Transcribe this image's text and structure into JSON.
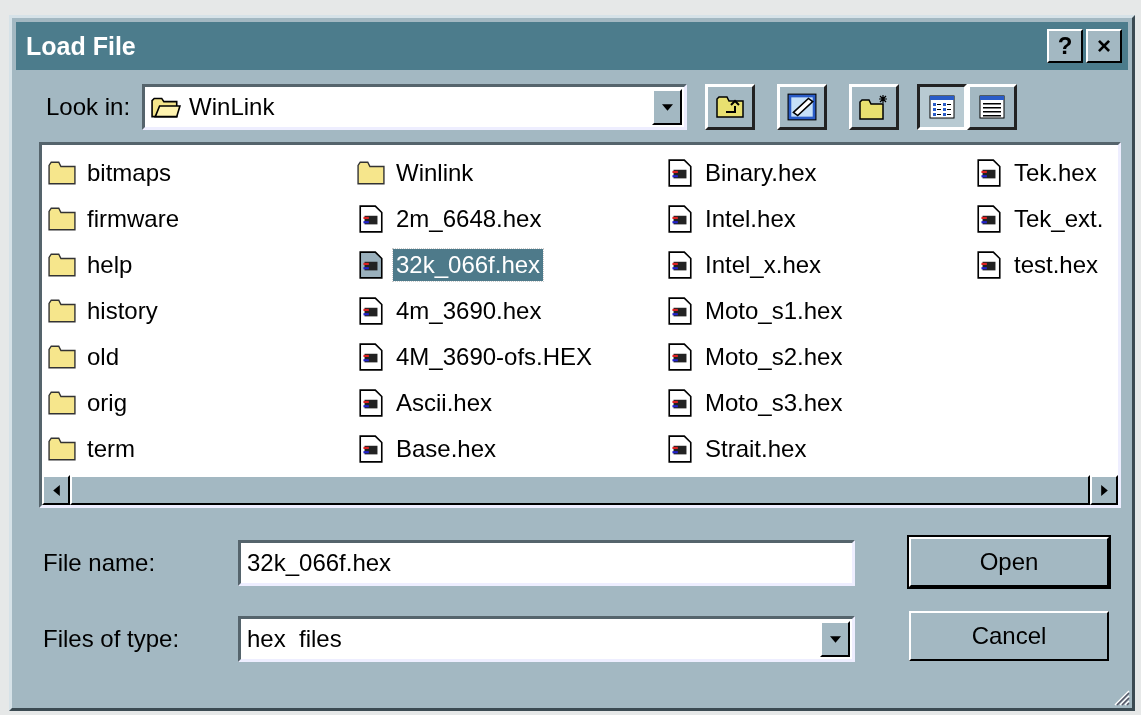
{
  "window": {
    "title": "Load File",
    "title_buttons": [
      "?",
      "×"
    ]
  },
  "look_in": {
    "label": "Look in:",
    "value": "WinLink"
  },
  "toolbar": [
    {
      "kind": "up",
      "selected": false
    },
    {
      "kind": "desktop",
      "selected": false
    },
    {
      "kind": "newfolder",
      "selected": false
    },
    {
      "kind": "list",
      "selected": true
    },
    {
      "kind": "details",
      "selected": false
    }
  ],
  "files": [
    {
      "name": "bitmaps",
      "kind": "folder",
      "selected": false
    },
    {
      "name": "firmware",
      "kind": "folder",
      "selected": false
    },
    {
      "name": "help",
      "kind": "folder",
      "selected": false
    },
    {
      "name": "history",
      "kind": "folder",
      "selected": false
    },
    {
      "name": "old",
      "kind": "folder",
      "selected": false
    },
    {
      "name": "orig",
      "kind": "folder",
      "selected": false
    },
    {
      "name": "term",
      "kind": "folder",
      "selected": false
    },
    {
      "name": "Winlink",
      "kind": "folder",
      "selected": false
    },
    {
      "name": "2m_6648.hex",
      "kind": "file",
      "selected": false
    },
    {
      "name": "32k_066f.hex",
      "kind": "file",
      "selected": true
    },
    {
      "name": "4m_3690.hex",
      "kind": "file",
      "selected": false
    },
    {
      "name": "4M_3690-ofs.HEX",
      "kind": "file",
      "selected": false
    },
    {
      "name": "Ascii.hex",
      "kind": "file",
      "selected": false
    },
    {
      "name": "Base.hex",
      "kind": "file",
      "selected": false
    },
    {
      "name": "Binary.hex",
      "kind": "file",
      "selected": false
    },
    {
      "name": "Intel.hex",
      "kind": "file",
      "selected": false
    },
    {
      "name": "Intel_x.hex",
      "kind": "file",
      "selected": false
    },
    {
      "name": "Moto_s1.hex",
      "kind": "file",
      "selected": false
    },
    {
      "name": "Moto_s2.hex",
      "kind": "file",
      "selected": false
    },
    {
      "name": "Moto_s3.hex",
      "kind": "file",
      "selected": false
    },
    {
      "name": "Strait.hex",
      "kind": "file",
      "selected": false
    },
    {
      "name": "Tek.hex",
      "kind": "file",
      "selected": false
    },
    {
      "name": "Tek_ext.",
      "kind": "file",
      "selected": false
    },
    {
      "name": "test.hex",
      "kind": "file",
      "selected": false
    }
  ],
  "file_name": {
    "label": "File name:",
    "value": "32k_066f.hex"
  },
  "file_type": {
    "label": "Files of type:",
    "value": "hex  files"
  },
  "buttons": [
    {
      "label": "Open",
      "default": true
    },
    {
      "label": "Cancel",
      "default": false
    }
  ]
}
